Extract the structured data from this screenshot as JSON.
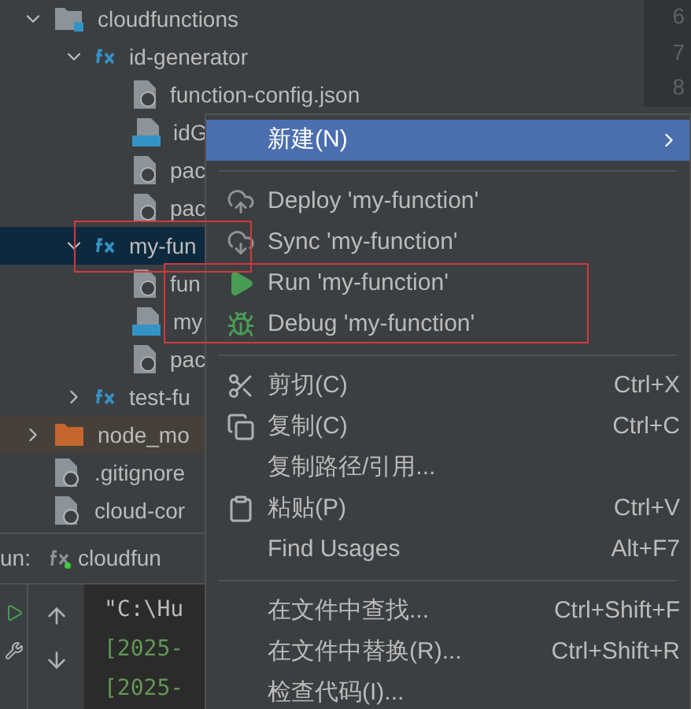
{
  "tree": [
    {
      "label": "cloudfunctions",
      "kind": "folder-cloud",
      "expanded": true,
      "selected": false
    },
    {
      "label": "id-generator",
      "kind": "function",
      "expanded": true,
      "selected": false
    },
    {
      "label": "function-config.json",
      "kind": "json",
      "selected": false
    },
    {
      "label": "idG",
      "kind": "ts",
      "selected": false
    },
    {
      "label": "pac",
      "kind": "json",
      "selected": false
    },
    {
      "label": "pac",
      "kind": "json",
      "selected": false
    },
    {
      "label": "my-fun",
      "kind": "function",
      "expanded": true,
      "selected": true
    },
    {
      "label": "fun",
      "kind": "json",
      "selected": false
    },
    {
      "label": "my",
      "kind": "ts",
      "selected": false
    },
    {
      "label": "pac",
      "kind": "json",
      "selected": false
    },
    {
      "label": "test-fu",
      "kind": "function",
      "expanded": false,
      "selected": false
    },
    {
      "label": "node_mo",
      "kind": "folder",
      "expanded": false,
      "selected": false
    },
    {
      "label": ".gitignore",
      "kind": "ignored",
      "selected": false
    },
    {
      "label": "cloud-cor",
      "kind": "ignored",
      "selected": false
    }
  ],
  "gutter": [
    "6",
    "7",
    "8"
  ],
  "run_panel": {
    "label": "un:",
    "tab": "cloudfun",
    "console": [
      {
        "text": "\"C:\\Hu",
        "kind": "command"
      },
      {
        "text": "[2025-",
        "kind": "log"
      },
      {
        "text": "[2025-",
        "kind": "log"
      }
    ]
  },
  "context_menu": [
    {
      "kind": "item",
      "label": "新建(N)",
      "submenu": true,
      "selected": true
    },
    {
      "kind": "separator"
    },
    {
      "kind": "item",
      "label": "Deploy 'my-function'",
      "selected": false
    },
    {
      "kind": "item",
      "label": "Sync 'my-function'",
      "selected": false
    },
    {
      "kind": "item",
      "label": "Run 'my-function'",
      "selected": false
    },
    {
      "kind": "item",
      "label": "Debug 'my-function'",
      "selected": false
    },
    {
      "kind": "separator"
    },
    {
      "kind": "item",
      "label": "剪切(C)",
      "shortcut": "Ctrl+X",
      "selected": false
    },
    {
      "kind": "item",
      "label": "复制(C)",
      "shortcut": "Ctrl+C",
      "selected": false
    },
    {
      "kind": "item",
      "label": "复制路径/引用...",
      "selected": false
    },
    {
      "kind": "item",
      "label": "粘贴(P)",
      "shortcut": "Ctrl+V",
      "selected": false
    },
    {
      "kind": "item",
      "label": "Find Usages",
      "shortcut": "Alt+F7",
      "selected": false
    },
    {
      "kind": "separator"
    },
    {
      "kind": "item",
      "label": "在文件中查找...",
      "shortcut": "Ctrl+Shift+F",
      "selected": false
    },
    {
      "kind": "item",
      "label": "在文件中替换(R)...",
      "shortcut": "Ctrl+Shift+R",
      "selected": false
    },
    {
      "kind": "item",
      "label": "检查代码(I)...",
      "selected": false
    }
  ]
}
